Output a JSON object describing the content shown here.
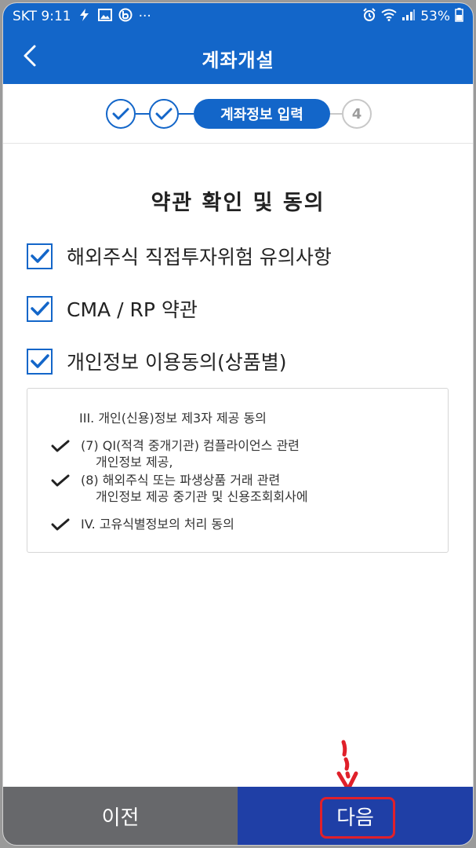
{
  "status_bar": {
    "carrier_time": "SKT 9:11",
    "more": "···",
    "battery": "53%",
    "icons": [
      "bolt-icon",
      "image-icon",
      "b-app-icon",
      "alarm-icon",
      "wifi-icon",
      "signal-icon",
      "battery-icon"
    ]
  },
  "header": {
    "title": "계좌개설",
    "back_icon": "chevron-left-icon"
  },
  "stepper": {
    "active_step_label": "계좌정보 입력",
    "next_step_number": "4",
    "completed_steps": 2
  },
  "terms": {
    "title": "약관 확인 및 동의",
    "items": [
      {
        "label": "해외주식 직접투자위험 유의사항",
        "checked": true
      },
      {
        "label": "CMA / RP 약관",
        "checked": true
      },
      {
        "label": "개인정보 이용동의(상품별)",
        "checked": true
      }
    ]
  },
  "details": {
    "heading": "III. 개인(신용)정보 제3자 제공 동의",
    "items": [
      {
        "line1": "(7) QI(적격 중개기관) 컴플라이언스 관련",
        "line2": "개인정보 제공,"
      },
      {
        "line1": "(8) 해외주식 또는 파생상품 거래 관련",
        "line2": "개인정보 제공 중기관 및 신용조회회사에"
      },
      {
        "line1": "IV. 고유식별정보의 처리 동의",
        "line2": ""
      }
    ]
  },
  "footer": {
    "prev_label": "이전",
    "next_label": "다음"
  },
  "colors": {
    "primary": "#1366c9",
    "next_button": "#1f3fa6",
    "prev_button": "#67686b",
    "highlight": "#e0202a"
  }
}
